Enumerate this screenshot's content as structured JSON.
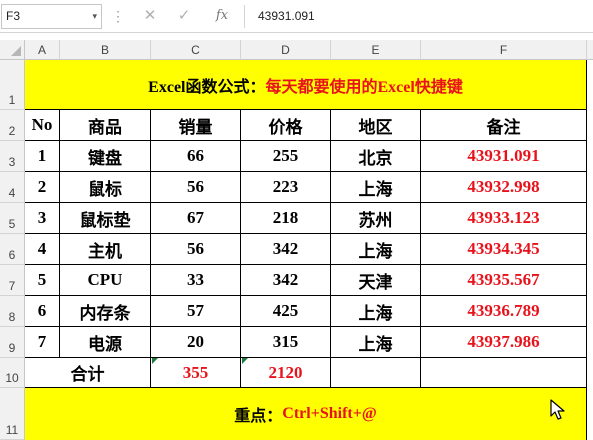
{
  "formula_bar": {
    "name_box": "F3",
    "dropdown_glyph": "▾",
    "dots_glyph": "⋮",
    "cancel_glyph": "✕",
    "enter_glyph": "✓",
    "fx_label": "fx",
    "formula_value": "43931.091"
  },
  "columns": [
    "A",
    "B",
    "C",
    "D",
    "E",
    "F"
  ],
  "rows": [
    "1",
    "2",
    "3",
    "4",
    "5",
    "6",
    "7",
    "8",
    "9",
    "10",
    "11"
  ],
  "sheet": {
    "title_black": "Excel函数公式：",
    "title_red": "每天都要使用的Excel快捷键",
    "headers": [
      "No",
      "商品",
      "销量",
      "价格",
      "地区",
      "备注"
    ],
    "data": [
      [
        "1",
        "键盘",
        "66",
        "255",
        "北京",
        "43931.091"
      ],
      [
        "2",
        "鼠标",
        "56",
        "223",
        "上海",
        "43932.998"
      ],
      [
        "3",
        "鼠标垫",
        "67",
        "218",
        "苏州",
        "43933.123"
      ],
      [
        "4",
        "主机",
        "56",
        "342",
        "上海",
        "43934.345"
      ],
      [
        "5",
        "CPU",
        "33",
        "342",
        "天津",
        "43935.567"
      ],
      [
        "6",
        "内存条",
        "57",
        "425",
        "上海",
        "43936.789"
      ],
      [
        "7",
        "电源",
        "20",
        "315",
        "上海",
        "43937.986"
      ]
    ],
    "total_label": "合计",
    "total_sales": "355",
    "total_price": "2120",
    "footer_black": "重点：",
    "footer_red": "Ctrl+Shift+@"
  },
  "colors": {
    "accent_red": "#e8121b",
    "highlight_yellow": "#ffff00",
    "header_grey": "#f1f1f1"
  }
}
